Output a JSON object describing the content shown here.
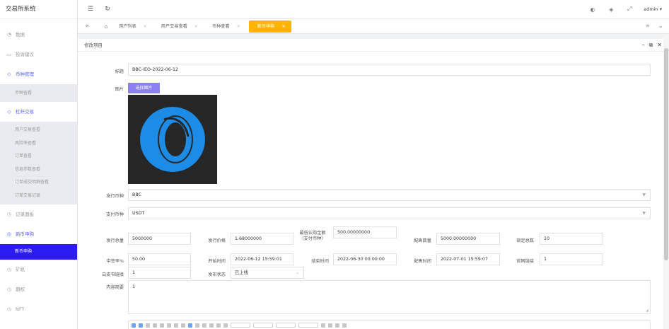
{
  "app": {
    "title": "交易所系统"
  },
  "sidebar": {
    "items": [
      {
        "label": "数据",
        "icon": "dashboard-icon",
        "open": false,
        "sub": []
      },
      {
        "label": "投诉建议",
        "icon": "message-icon",
        "open": false,
        "sub": []
      },
      {
        "label": "币种管理",
        "icon": "diamond-icon",
        "open": true,
        "sub": [
          {
            "label": "币种查看",
            "active": false
          }
        ]
      },
      {
        "label": "杠杆交易",
        "icon": "diamond-icon",
        "open": true,
        "sub": [
          {
            "label": "用户交易查看",
            "active": false
          },
          {
            "label": "风险率查看",
            "active": false
          },
          {
            "label": "订单查看",
            "active": false
          },
          {
            "label": "信息参数查看",
            "active": false
          },
          {
            "label": "订单成交明细查看",
            "active": false
          },
          {
            "label": "订单交易记录",
            "active": false
          }
        ]
      },
      {
        "label": "记录面板",
        "icon": "clock-icon",
        "open": false,
        "sub": []
      },
      {
        "label": "新币申购",
        "icon": "target-icon",
        "open": true,
        "sub": [
          {
            "label": "新币申购",
            "active": true
          }
        ]
      },
      {
        "label": "矿机",
        "icon": "clock-icon",
        "open": false,
        "sub": []
      },
      {
        "label": "期权",
        "icon": "clock-icon",
        "open": false,
        "sub": []
      },
      {
        "label": "NFT",
        "icon": "clock-icon",
        "open": false,
        "sub": []
      }
    ]
  },
  "topbar": {
    "user": "admin"
  },
  "tabs": [
    {
      "label": "用户列表",
      "active": false
    },
    {
      "label": "用户交易查看",
      "active": false
    },
    {
      "label": "币种查看",
      "active": false
    },
    {
      "label": "新币申购",
      "active": true
    }
  ],
  "card": {
    "title": "修改项目"
  },
  "form": {
    "title_label": "标题",
    "title_value": "BBC-IEO-2022-06-12",
    "image_label": "图片",
    "choose_image": "选择图片",
    "issue_coin_label": "发行币种",
    "issue_coin_value": "BBC",
    "pay_coin_label": "支付币种",
    "pay_coin_value": "USDT",
    "total_label": "发行总量",
    "total_value": "5000000",
    "price_label": "发行价格",
    "price_value": "1.68000000",
    "min_label": "最低认购金额（支付币种）",
    "min_value": "500.00000000",
    "alloc_qty_label": "配售数量",
    "alloc_qty_value": "5000.00000000",
    "lock_label": "锁定总数",
    "lock_value": "10",
    "win_rate_label": "中签率%",
    "win_rate_value": "50.00",
    "start_label": "开始时间",
    "start_value": "2022-06-12 15:59:01",
    "end_label": "结束时间",
    "end_value": "2022-06-30 00:00:00",
    "alloc_time_label": "配售时间",
    "alloc_time_value": "2022-07-01 15:59:07",
    "site_link_label": "官网链接",
    "site_link_value": "1",
    "whitepaper_label": "白皮书链接",
    "whitepaper_value": "1",
    "status_label": "发布状态",
    "status_value": "已上线",
    "content_label": "内容简要",
    "content_value": "1"
  }
}
